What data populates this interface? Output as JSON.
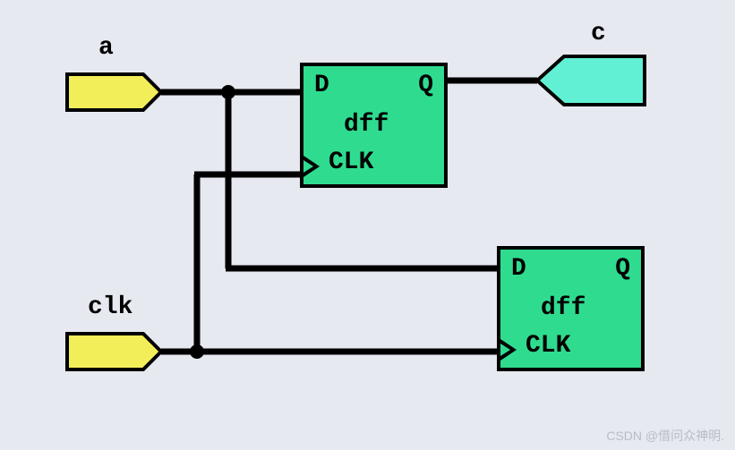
{
  "ports": {
    "a": {
      "label": "a"
    },
    "clk": {
      "label": "clk"
    },
    "c": {
      "label": "c"
    }
  },
  "dff1": {
    "d": "D",
    "q": "Q",
    "name": "dff",
    "clk": "CLK"
  },
  "dff2": {
    "d": "D",
    "q": "Q",
    "name": "dff",
    "clk": "CLK"
  },
  "watermark": "CSDN @借问众神明."
}
